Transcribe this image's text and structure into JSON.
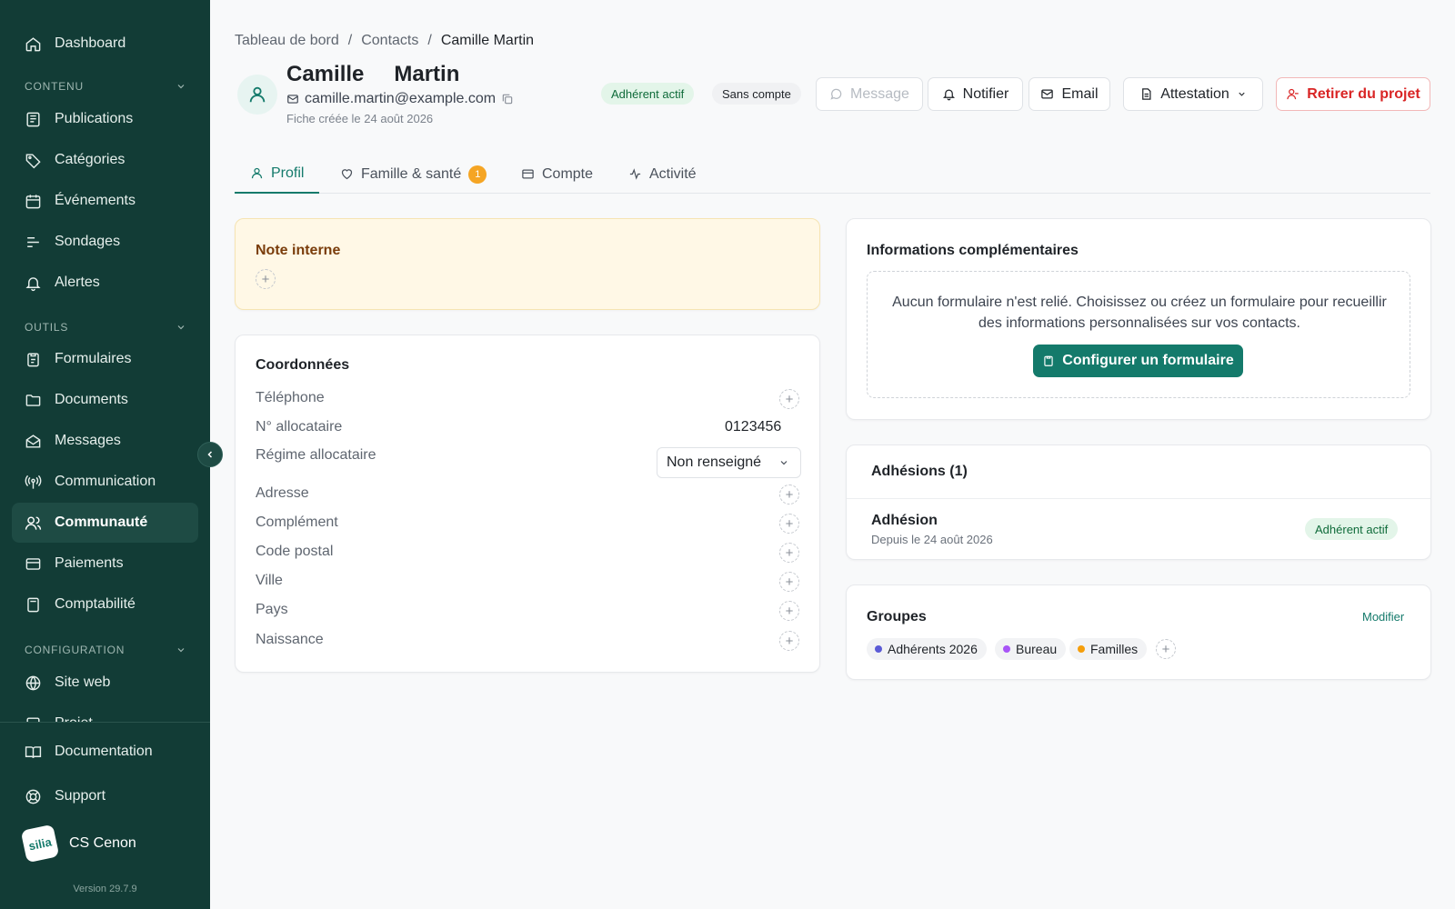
{
  "sidebar": {
    "items": {
      "dashboard": "Dashboard",
      "publications": "Publications",
      "categories": "Catégories",
      "events": "Événements",
      "polls": "Sondages",
      "alerts": "Alertes",
      "forms": "Formulaires",
      "documents": "Documents",
      "messages": "Messages",
      "communication": "Communication",
      "community": "Communauté",
      "payments": "Paiements",
      "accounting": "Comptabilité",
      "website": "Site web",
      "project": "Projet",
      "documentation": "Documentation",
      "support": "Support"
    },
    "sections": {
      "content": "Contenu",
      "tools": "Outils",
      "configuration": "Configuration"
    },
    "org": {
      "logo": "silia",
      "name": "CS Cenon"
    },
    "version": "Version 29.7.9"
  },
  "breadcrumb": {
    "root": "Tableau de bord",
    "sep": "/",
    "contacts": "Contacts",
    "current": "Camille Martin"
  },
  "contact": {
    "first_name": "Camille",
    "last_name": "Martin",
    "email": "camille.martin@example.com",
    "created": "Fiche créée le 24 août 2026",
    "badges": {
      "status": "Adhérent actif",
      "account": "Sans compte"
    }
  },
  "actions": {
    "message": "Message",
    "notify": "Notifier",
    "email": "Email",
    "certificate": "Attestation",
    "remove": "Retirer du projet"
  },
  "tabs": {
    "profile": "Profil",
    "family": "Famille & santé",
    "family_count": "1",
    "account": "Compte",
    "activity": "Activité"
  },
  "note": {
    "title": "Note interne"
  },
  "coords": {
    "title": "Coordonnées",
    "phone": "Téléphone",
    "caf_number_label": "N° allocataire",
    "caf_number_value": "0123456",
    "regime_label": "Régime allocataire",
    "regime_value": "Non renseigné",
    "address": "Adresse",
    "complement": "Complément",
    "postal_code": "Code postal",
    "city": "Ville",
    "country": "Pays",
    "birth": "Naissance"
  },
  "info": {
    "title": "Informations complémentaires",
    "empty_text": "Aucun formulaire n'est relié. Choisissez ou créez un formulaire pour recueillir des informations personnalisées sur vos contacts.",
    "configure": "Configurer un formulaire"
  },
  "memberships": {
    "title": "Adhésions (1)",
    "item_title": "Adhésion",
    "item_since": "Depuis le 24 août 2026",
    "item_status": "Adhérent actif"
  },
  "groups": {
    "title": "Groupes",
    "edit": "Modifier",
    "items": [
      {
        "label": "Adhérents 2026",
        "color": "#5b5bd6"
      },
      {
        "label": "Bureau",
        "color": "#a855f7"
      },
      {
        "label": "Familles",
        "color": "#f59e0b"
      }
    ]
  },
  "colors": {
    "sidebar_bg": "#123c36",
    "accent": "#147a6b",
    "danger": "#d92525",
    "note_bg": "#fff8e6"
  }
}
